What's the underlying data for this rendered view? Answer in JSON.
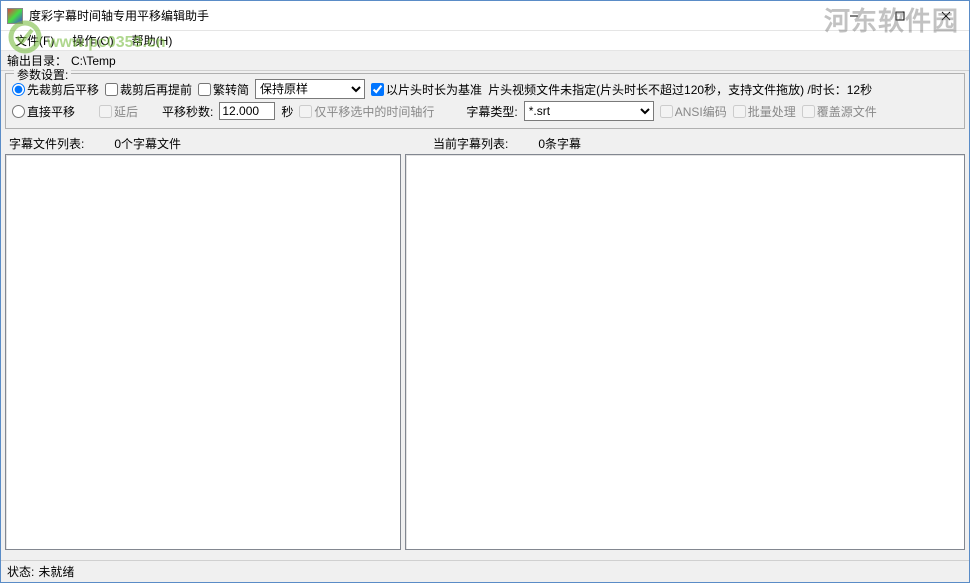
{
  "window": {
    "title": "度彩字幕时间轴专用平移编辑助手"
  },
  "menu": {
    "file": "文件(F)",
    "operate": "操作(O)",
    "help": "帮助(H)"
  },
  "output": {
    "label": "输出目录：",
    "path": "C:\\Temp"
  },
  "params": {
    "legend": "参数设置:",
    "opt_crop_then_shift": "先裁剪后平移",
    "opt_crop_then_advance": "裁剪后再提前",
    "opt_fan_to_simp": "繁转简",
    "keep_select": "保持原样",
    "base_on_head_duration": "以片头时长为基准",
    "head_info": "片头视频文件未指定(片头时长不超过120秒，支持文件拖放) /时长：12秒",
    "opt_direct_shift": "直接平移",
    "opt_delay": "延后",
    "shift_seconds_label": "平移秒数:",
    "shift_seconds_value": "12.000",
    "seconds_unit": "秒",
    "only_selected_rows": "仅平移选中的时间轴行",
    "subtitle_type_label": "字幕类型:",
    "subtitle_type_value": "*.srt",
    "ansi_encoding": "ANSI编码",
    "batch_process": "批量处理",
    "overwrite_source": "覆盖源文件"
  },
  "lists": {
    "file_list_label": "字幕文件列表:",
    "file_count": "0个字幕文件",
    "current_list_label": "当前字幕列表:",
    "line_count": "0条字幕"
  },
  "status": {
    "label": "状态:",
    "text": "未就绪"
  },
  "watermark": {
    "url": "www.pc0359.cn",
    "site": "河东软件园"
  }
}
